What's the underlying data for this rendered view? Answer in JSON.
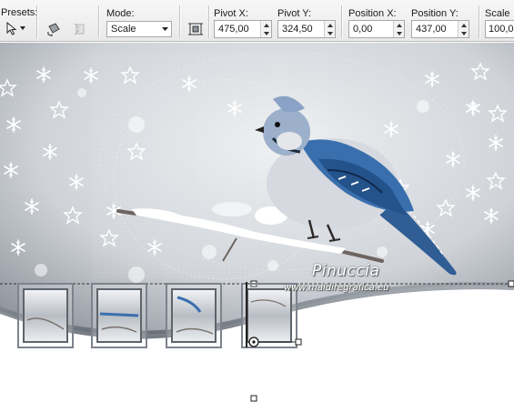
{
  "toolbar": {
    "presets": {
      "label": "Presets:"
    },
    "mode": {
      "label": "Mode:",
      "value": "Scale"
    },
    "pivot_x": {
      "label": "Pivot X:",
      "value": "475,00"
    },
    "pivot_y": {
      "label": "Pivot Y:",
      "value": "324,50"
    },
    "position_x": {
      "label": "Position X:",
      "value": "0,00"
    },
    "position_y": {
      "label": "Position Y:",
      "value": "437,00"
    },
    "scale": {
      "label": "Scale",
      "value": "100,0"
    },
    "icons": [
      "pick-tool-arrow-icon",
      "rotate-object-icon",
      "reset-object-icon",
      "position-grid-icon",
      "spin-up-icon",
      "spin-down-icon"
    ]
  },
  "canvas": {
    "watermark_name": "Pinuccia",
    "watermark_url": "www.maidiregrafica.eu",
    "thumbnail_count": 4,
    "colors": {
      "sky": "#dfe2e6",
      "bird_blue": "#3a6fae",
      "bird_belly": "#d9dce2",
      "frame": "#6b707a",
      "selection": "#333333"
    }
  }
}
